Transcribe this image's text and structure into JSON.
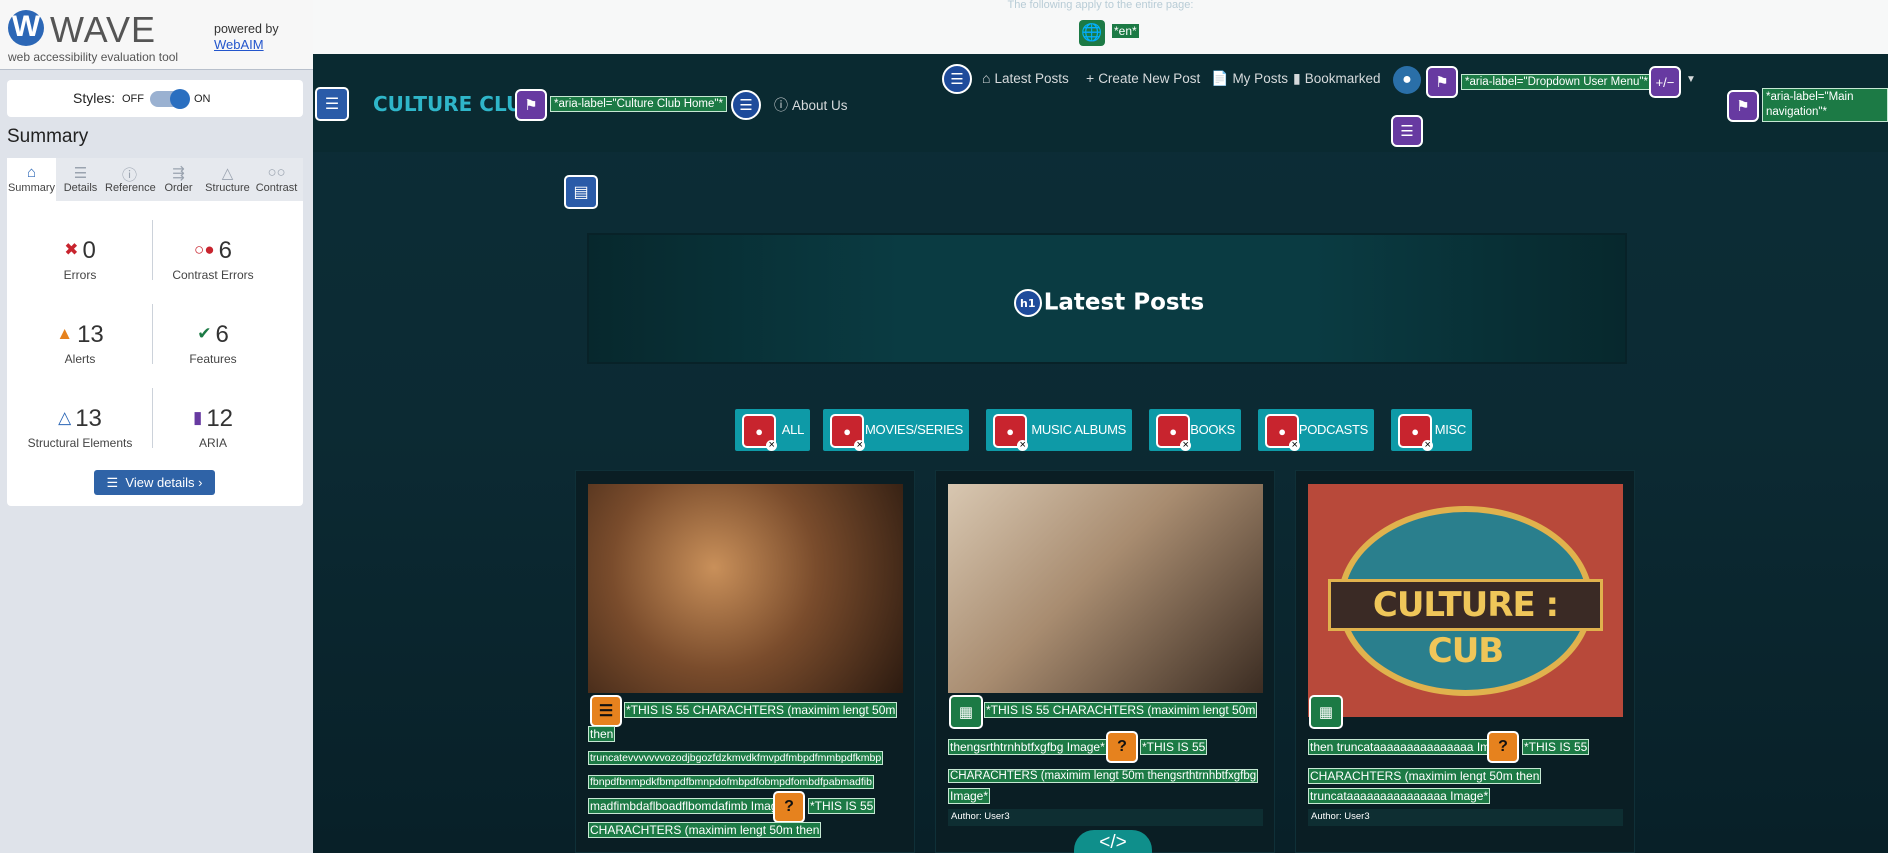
{
  "wave": {
    "logo_letter": "W",
    "title": "WAVE",
    "tagline": "web accessibility evaluation tool",
    "powered_by": "powered by",
    "webaim": "WebAIM",
    "styles_label": "Styles:",
    "styles_off": "OFF",
    "styles_on": "ON",
    "summary_title": "Summary",
    "tabs": [
      {
        "label": "Summary",
        "icon": "home-icon",
        "active": true
      },
      {
        "label": "Details",
        "icon": "list-icon"
      },
      {
        "label": "Reference",
        "icon": "info-icon"
      },
      {
        "label": "Order",
        "icon": "order-icon"
      },
      {
        "label": "Structure",
        "icon": "structure-icon"
      },
      {
        "label": "Contrast",
        "icon": "contrast-icon"
      }
    ],
    "stats": [
      {
        "count": "0",
        "label": "Errors",
        "icon": "error-icon",
        "color": "#c8242e"
      },
      {
        "count": "6",
        "label": "Contrast Errors",
        "icon": "contrast-error-icon",
        "color": "#c8242e"
      },
      {
        "count": "13",
        "label": "Alerts",
        "icon": "alert-icon",
        "color": "#e6821e"
      },
      {
        "count": "6",
        "label": "Features",
        "icon": "feature-icon",
        "color": "#1c7a45"
      },
      {
        "count": "13",
        "label": "Structural Elements",
        "icon": "structure-icon",
        "color": "#2c67b6"
      },
      {
        "count": "12",
        "label": "ARIA",
        "icon": "aria-icon",
        "color": "#673aa1"
      }
    ],
    "view_details": "View details ›"
  },
  "page": {
    "notice": "The following apply to the entire page:",
    "lang_tag": "*en*",
    "brand": "CULTURE CLUB",
    "brand_aria": "*aria-label=\"Culture Club Home\"*",
    "about": "About Us",
    "nav_links": [
      {
        "label": "Latest Posts",
        "icon": "home-icon"
      },
      {
        "label": "Create New Post",
        "icon": "plus-icon"
      },
      {
        "label": "My Posts",
        "icon": "file-icon"
      },
      {
        "label": "Bookmarked",
        "icon": "bookmark-icon"
      }
    ],
    "dropdown_aria": "*aria-label=\"Dropdown User Menu\"*",
    "plus_minus": "+/−",
    "main_nav_aria": "*aria-label=\"Main navigation\"*",
    "hero_title": "Latest Posts",
    "h1_badge": "h1",
    "filters": [
      "ALL",
      "MOVIES/SERIES",
      "MUSIC ALBUMS",
      "BOOKS",
      "PODCASTS",
      "MISC"
    ],
    "cards": [
      {
        "lines": [
          "*THIS IS 55 CHARACHTERS (maximim lengt 50m",
          "then",
          "truncatevvvvvvvozodjbgozfdzkmvdkfmvpdfmbpdfmmbpdfkmbp",
          "fbnpdfbnmpdkfbmpdfbmnpdofmbpdfobmpdfombdfpabmadfib",
          "madfimbdaflboadflbomdafimb Image*",
          "*THIS IS 55",
          "CHARACHTERS (maximim lengt 50m then"
        ]
      },
      {
        "lines": [
          "*THIS IS 55 CHARACHTERS (maximim lengt 50m",
          "thengsrthtrnhbtfxgfbg Image*",
          "*THIS IS 55",
          "CHARACHTERS (maximim lengt 50m thengsrthtrnhbtfxgfbg",
          "Image*"
        ],
        "author": "Author: User3"
      },
      {
        "lines": [
          "then truncataaaaaaaaaaaaaaa Image*",
          "*THIS IS 55",
          "CHARACHTERS (maximim lengt 50m then",
          "truncataaaaaaaaaaaaaaa Image*"
        ],
        "author": "Author: User3",
        "logo_text": "CULTURE : CUB"
      }
    ],
    "code_toggle": "</>"
  }
}
